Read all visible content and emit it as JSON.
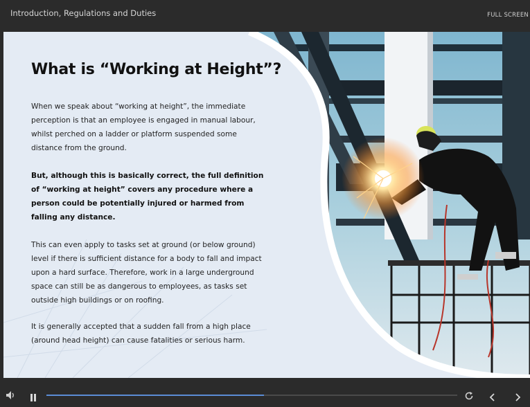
{
  "header": {
    "course_title": "Introduction, Regulations and Duties",
    "fullscreen_label": "FULL SCREEN"
  },
  "slide": {
    "heading": "What is “Working at Height”?",
    "paragraphs": [
      "When we speak about “working at height”, the immediate perception is that an employee is engaged in manual labour, whilst perched on a ladder or platform suspended some distance from the ground.",
      "But, although this is basically correct, the full definition of “working at height” covers any procedure where a person could be potentially injured or harmed from falling any distance.",
      "This can even apply to tasks set at ground (or below ground) level if there is sufficient distance for a body to fall and impact upon a hard surface. Therefore, work in a large underground space can still be as dangerous to employees, as tasks set outside high buildings or on roofing.",
      "It is generally accepted that a sudden fall from a high place (around head height) can cause fatalities or serious harm."
    ]
  },
  "player": {
    "progress_fraction": 0.53,
    "controls": [
      "volume-icon",
      "pause-icon",
      "replay-icon",
      "previous-icon",
      "next-icon"
    ],
    "accent_color": "#5b8dd6"
  }
}
